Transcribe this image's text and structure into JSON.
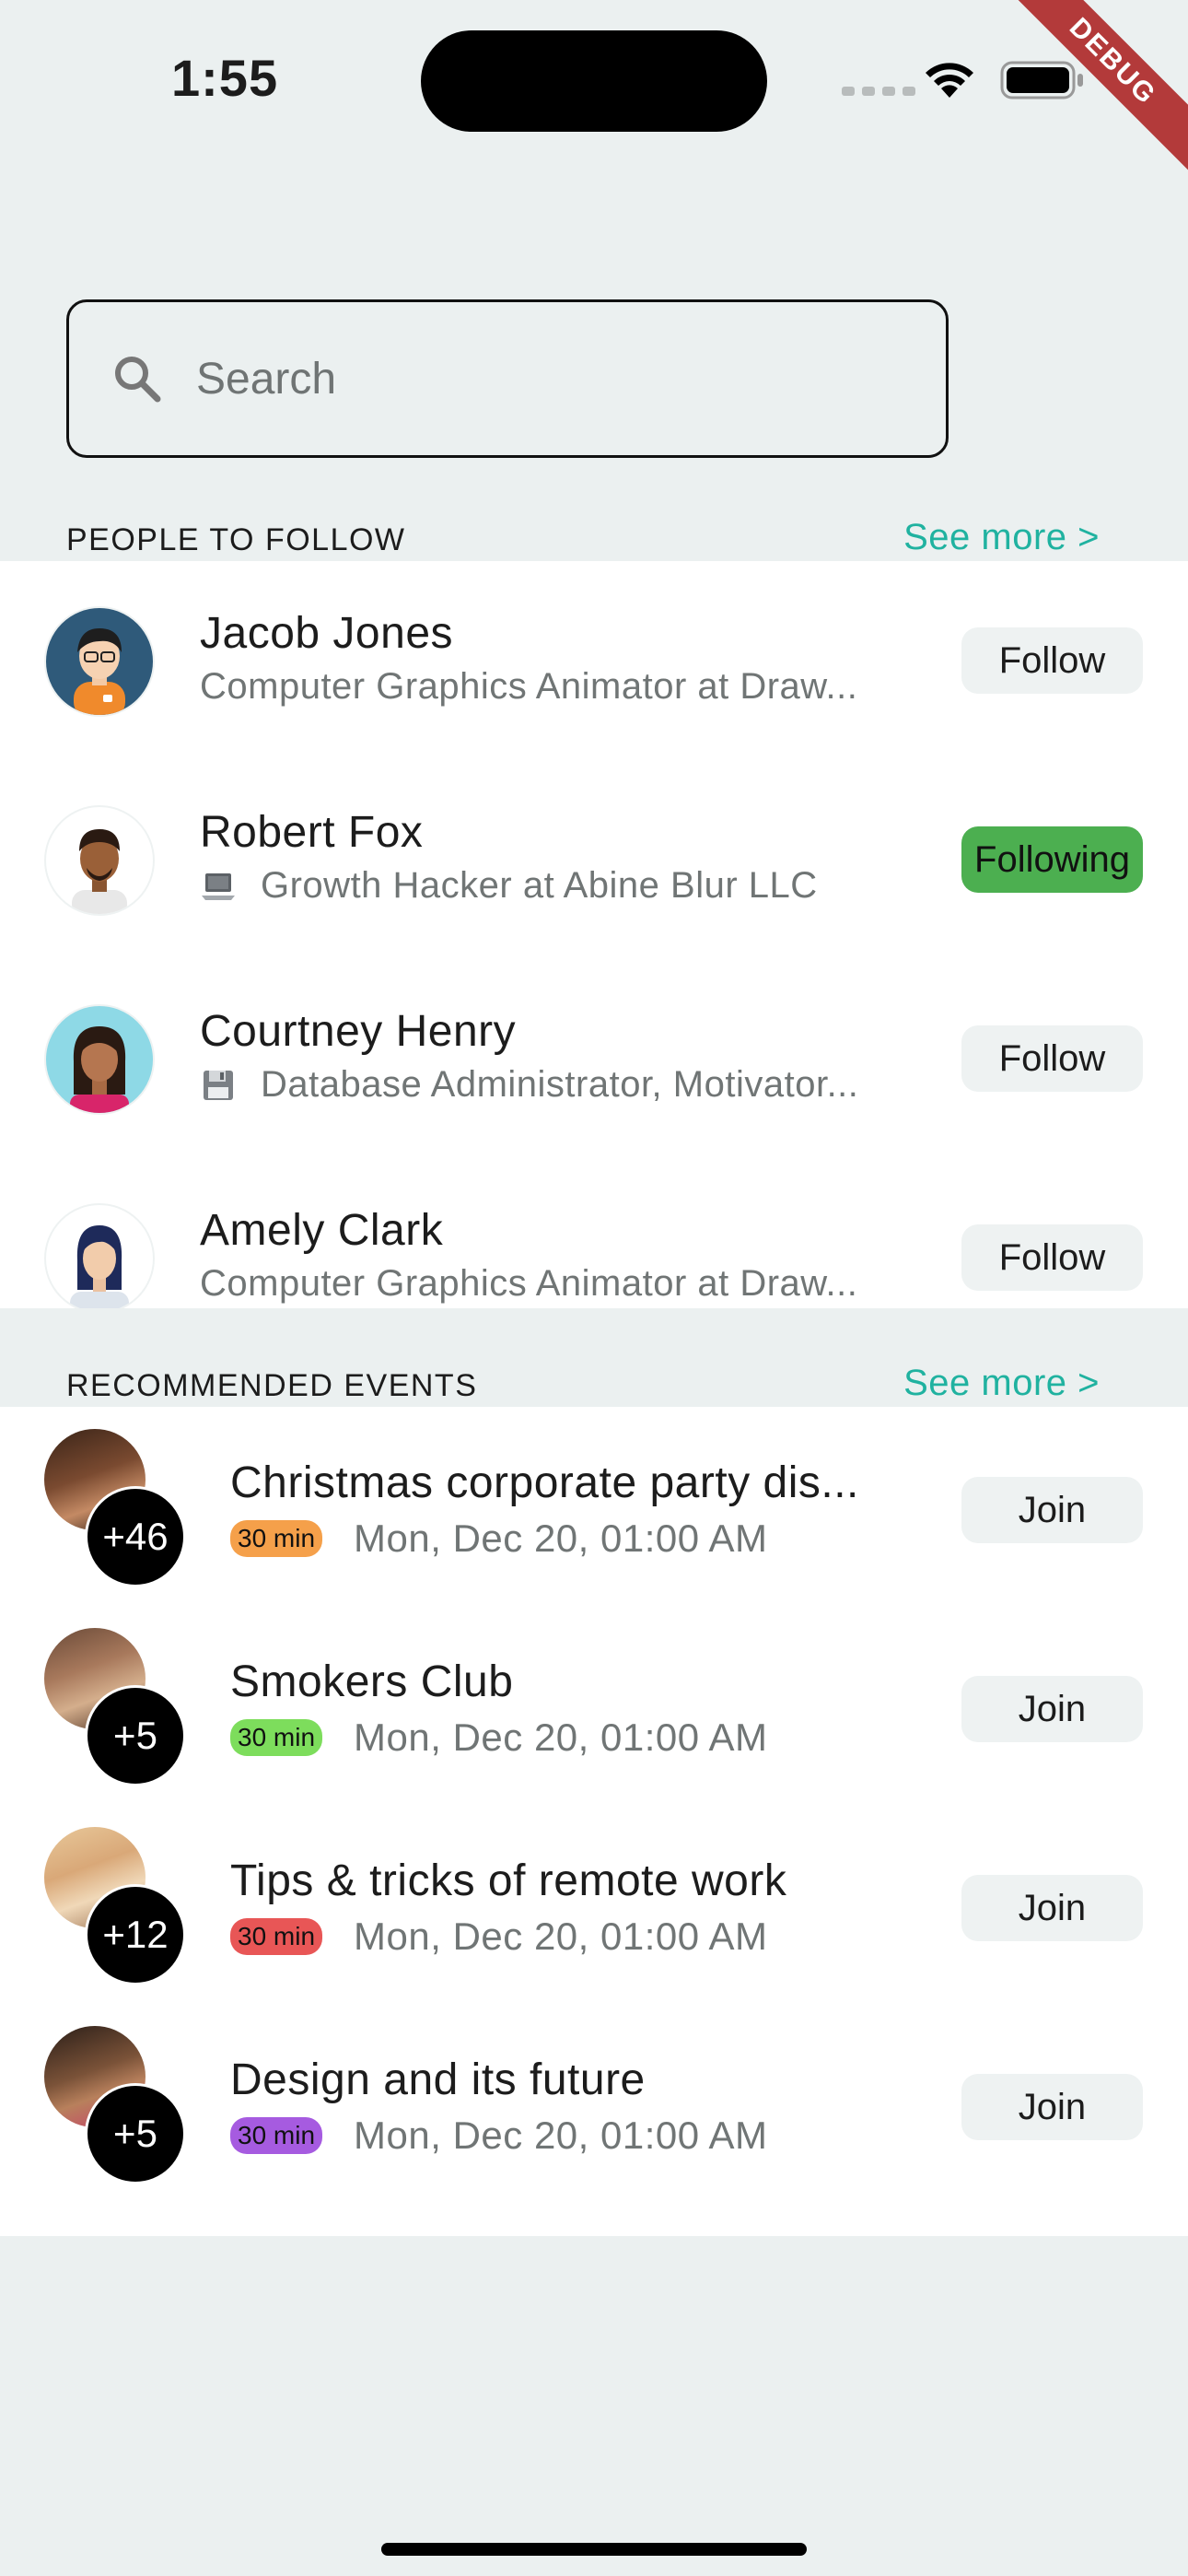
{
  "status_bar": {
    "time": "1:55",
    "debug_label": "DEBUG"
  },
  "search": {
    "placeholder": "Search"
  },
  "people_section": {
    "title": "PEOPLE TO FOLLOW",
    "see_more": "See more >",
    "people": [
      {
        "name": "Jacob Jones",
        "subtitle": "Computer Graphics Animator at Draw...",
        "icon": "",
        "button": "Follow",
        "following": false
      },
      {
        "name": "Robert Fox",
        "subtitle": "Growth Hacker at Abine Blur LLC",
        "icon": "laptop-icon",
        "button": "Following",
        "following": true
      },
      {
        "name": "Courtney Henry",
        "subtitle": "Database Administrator, Motivator...",
        "icon": "floppy-disk-icon",
        "button": "Follow",
        "following": false
      },
      {
        "name": "Amely Clark",
        "subtitle": "Computer Graphics Animator at Draw...",
        "icon": "",
        "button": "Follow",
        "following": false
      }
    ]
  },
  "events_section": {
    "title": "RECOMMENDED EVENTS",
    "see_more": "See more >",
    "events": [
      {
        "title": "Christmas corporate party dis...",
        "attendees": "+46",
        "duration": "30 min",
        "duration_color": "#F5A04A",
        "date": "Mon, Dec 20, 01:00 AM",
        "button": "Join"
      },
      {
        "title": "Smokers Club",
        "attendees": "+5",
        "duration": "30 min",
        "duration_color": "#7DDD5C",
        "date": "Mon, Dec 20, 01:00 AM",
        "button": "Join"
      },
      {
        "title": "Tips & tricks  of remote work",
        "attendees": "+12",
        "duration": "30 min",
        "duration_color": "#E85656",
        "date": "Mon, Dec 20, 01:00 AM",
        "button": "Join"
      },
      {
        "title": "Design and its future",
        "attendees": "+5",
        "duration": "30 min",
        "duration_color": "#A65BE0",
        "date": "Mon, Dec 20, 01:00 AM",
        "button": "Join"
      }
    ]
  },
  "colors": {
    "accent": "#20B2A0",
    "following": "#4CAF50",
    "background": "#EBF0F0"
  }
}
